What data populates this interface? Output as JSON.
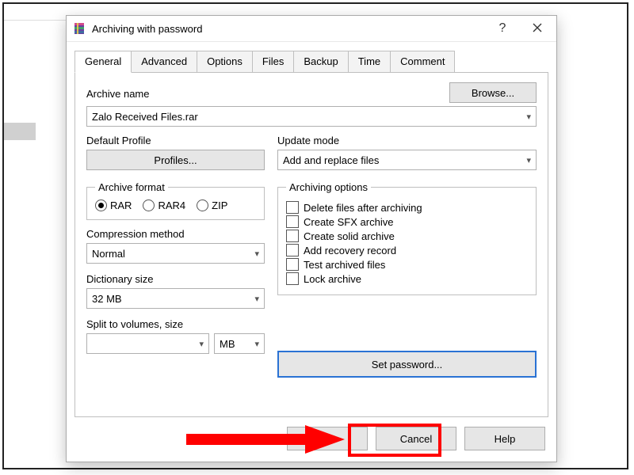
{
  "window": {
    "title": "Archiving with password",
    "help_glyph": "?",
    "close_glyph": "✕"
  },
  "tabs": [
    "General",
    "Advanced",
    "Options",
    "Files",
    "Backup",
    "Time",
    "Comment"
  ],
  "general": {
    "archive_name_label": "Archive name",
    "browse_label": "Browse...",
    "archive_name_value": "Zalo Received Files.rar",
    "default_profile_label": "Default Profile",
    "profiles_btn": "Profiles...",
    "update_mode_label": "Update mode",
    "update_mode_value": "Add and replace files",
    "archive_format_legend": "Archive format",
    "formats": {
      "rar": "RAR",
      "rar4": "RAR4",
      "zip": "ZIP",
      "selected": "rar"
    },
    "compression_label": "Compression method",
    "compression_value": "Normal",
    "dictionary_label": "Dictionary size",
    "dictionary_value": "32 MB",
    "split_label": "Split to volumes, size",
    "split_value": "",
    "split_unit": "MB",
    "archiving_options_legend": "Archiving options",
    "options": [
      "Delete files after archiving",
      "Create SFX archive",
      "Create solid archive",
      "Add recovery record",
      "Test archived files",
      "Lock archive"
    ],
    "set_password_label": "Set password..."
  },
  "footer": {
    "ok": "OK",
    "cancel": "Cancel",
    "help": "Help"
  }
}
